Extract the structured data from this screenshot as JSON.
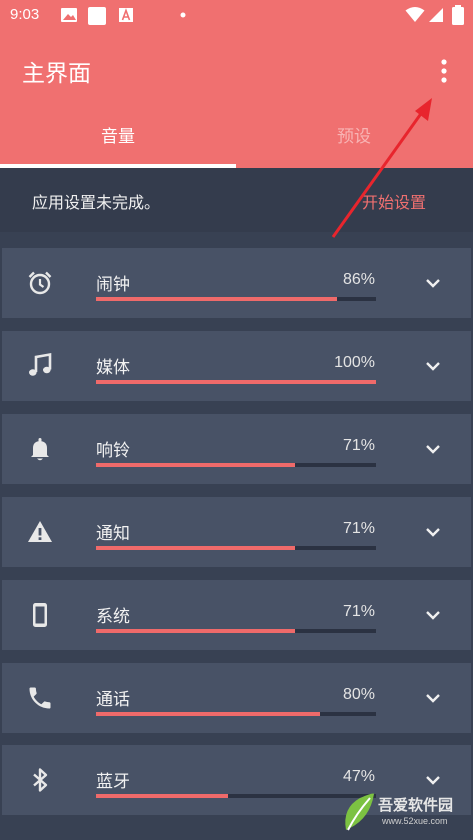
{
  "status_bar": {
    "time": "9:03"
  },
  "app_bar": {
    "title": "主界面"
  },
  "tabs": [
    {
      "label": "音量",
      "selected": true
    },
    {
      "label": "预设",
      "selected": false
    }
  ],
  "setup": {
    "message": "应用设置未完成。",
    "action": "开始设置"
  },
  "channels": [
    {
      "label": "闹钟",
      "percent_text": "86%",
      "level": 0.86,
      "icon": "alarm-icon"
    },
    {
      "label": "媒体",
      "percent_text": "100%",
      "level": 1.0,
      "icon": "music-note-icon"
    },
    {
      "label": "响铃",
      "percent_text": "71%",
      "level": 0.71,
      "icon": "bell-icon"
    },
    {
      "label": "通知",
      "percent_text": "71%",
      "level": 0.71,
      "icon": "warning-icon"
    },
    {
      "label": "系统",
      "percent_text": "71%",
      "level": 0.71,
      "icon": "phone-device-icon"
    },
    {
      "label": "通话",
      "percent_text": "80%",
      "level": 0.8,
      "icon": "phone-call-icon"
    },
    {
      "label": "蓝牙",
      "percent_text": "47%",
      "level": 0.47,
      "icon": "bluetooth-icon"
    }
  ],
  "watermark": {
    "text": "吾爱软件园",
    "url": "www.52xue.com"
  },
  "colors": {
    "accent": "#f07070",
    "background": "#384153",
    "row": "#485266",
    "track": "#2b3242",
    "annotation": "#e8252d"
  }
}
